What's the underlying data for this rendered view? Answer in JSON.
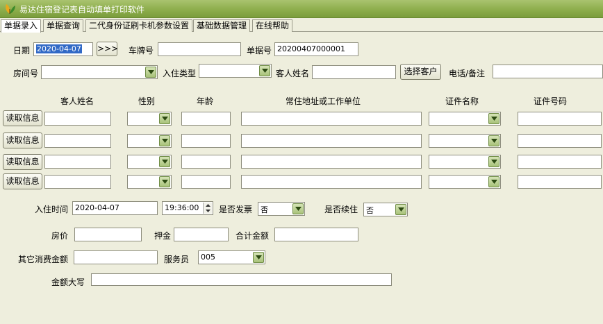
{
  "window": {
    "title": "易达住宿登记表自动填单打印软件"
  },
  "tabs": [
    "单据录入",
    "单据查询",
    "二代身份证刷卡机参数设置",
    "基础数据管理",
    "在线帮助"
  ],
  "header": {
    "date_label": "日期",
    "date_value": "2020-04-07",
    "date_button": ">>>",
    "plate_label": "车牌号",
    "plate_value": "",
    "doc_no_label": "单据号",
    "doc_no_value": "20200407000001"
  },
  "room_row": {
    "room_label": "房间号",
    "room_value": "",
    "checkin_type_label": "入住类型",
    "checkin_type_value": "",
    "guest_name_label": "客人姓名",
    "guest_name_value": "",
    "select_guest_button": "选择客户",
    "phone_label": "电话/备注",
    "phone_value": ""
  },
  "guests_table": {
    "columns": [
      "客人姓名",
      "性别",
      "年龄",
      "常住地址或工作单位",
      "证件名称",
      "证件号码"
    ],
    "read_button": "读取信息",
    "rows": [
      {
        "name": "",
        "gender": "",
        "age": "",
        "address": "",
        "id_type": "",
        "id_no": ""
      },
      {
        "name": "",
        "gender": "",
        "age": "",
        "address": "",
        "id_type": "",
        "id_no": ""
      },
      {
        "name": "",
        "gender": "",
        "age": "",
        "address": "",
        "id_type": "",
        "id_no": ""
      },
      {
        "name": "",
        "gender": "",
        "age": "",
        "address": "",
        "id_type": "",
        "id_no": ""
      }
    ]
  },
  "checkin": {
    "time_label": "入住时间",
    "date_value": "2020-04-07",
    "time_value": "19:36:00",
    "invoice_label": "是否发票",
    "invoice_value": "否",
    "continue_label": "是否续住",
    "continue_value": "否"
  },
  "fees": {
    "price_label": "房价",
    "price_value": "",
    "deposit_label": "押金",
    "deposit_value": "",
    "total_label": "合计金额",
    "total_value": "",
    "other_label": "其它消费金额",
    "other_value": "",
    "staff_label": "服务员",
    "staff_value": "005",
    "uppercase_label": "金额大写",
    "uppercase_value": ""
  },
  "icons": {
    "app": "leaf-app-icon",
    "dropdown": "chevron-down-icon",
    "spin": "spin-arrows-icon"
  },
  "colors": {
    "titlebar": "#8dae4c",
    "background": "#eeeedd",
    "selection": "#3169c6"
  }
}
